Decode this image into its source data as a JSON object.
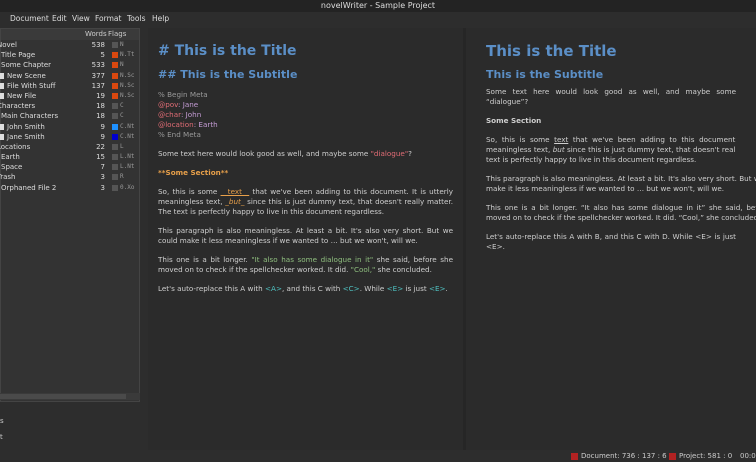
{
  "window": {
    "title": "novelWriter - Sample Project"
  },
  "menu": [
    "t",
    "Document",
    "Edit",
    "View",
    "Format",
    "Tools",
    "Help"
  ],
  "tree": {
    "headers": {
      "words": "Words",
      "flags": "Flags"
    },
    "rows": [
      {
        "name": "Novel",
        "words": "538",
        "color": "#555555",
        "flags": "N",
        "indent": 0,
        "file": false
      },
      {
        "name": "Title Page",
        "words": "5",
        "color": "#d9480f",
        "flags": "N.Tt",
        "indent": 1,
        "file": false
      },
      {
        "name": "Some Chapter",
        "words": "533",
        "color": "#d9480f",
        "flags": "N",
        "indent": 1,
        "file": false
      },
      {
        "name": "New Scene",
        "words": "377",
        "color": "#d9480f",
        "flags": "N.Sc",
        "indent": 2,
        "file": true
      },
      {
        "name": "File With Stuff",
        "words": "137",
        "color": "#d9480f",
        "flags": "N.Sc",
        "indent": 2,
        "file": true
      },
      {
        "name": "New File",
        "words": "19",
        "color": "#d9480f",
        "flags": "N.Sc",
        "indent": 2,
        "file": true
      },
      {
        "name": "Characters",
        "words": "18",
        "color": "#555555",
        "flags": "C",
        "indent": 0,
        "file": false
      },
      {
        "name": "Main Characters",
        "words": "18",
        "color": "#555555",
        "flags": "C",
        "indent": 1,
        "file": false
      },
      {
        "name": "John Smith",
        "words": "9",
        "color": "#1e90ff",
        "flags": "C.Nt",
        "indent": 2,
        "file": true
      },
      {
        "name": "Jane Smith",
        "words": "9",
        "color": "#0000cd",
        "flags": "C.Nt",
        "indent": 2,
        "file": true
      },
      {
        "name": "Locations",
        "words": "22",
        "color": "#555555",
        "flags": "L",
        "indent": 0,
        "file": false
      },
      {
        "name": "Earth",
        "words": "15",
        "color": "#555555",
        "flags": "L.Nt",
        "indent": 1,
        "file": false
      },
      {
        "name": "Space",
        "words": "7",
        "color": "#555555",
        "flags": "L.Nt",
        "indent": 1,
        "file": false
      },
      {
        "name": "Trash",
        "words": "3",
        "color": "#555555",
        "flags": "R",
        "indent": 0,
        "file": false
      },
      {
        "name": "Orphaned File 2",
        "words": "3",
        "color": "#555555",
        "flags": "0.Xo",
        "indent": 1,
        "file": false
      }
    ]
  },
  "side_extra": [
    "s",
    "t"
  ],
  "editor": {
    "title": "# This is the Title",
    "subtitle": "## This is the Subtitle",
    "meta_begin": "% Begin Meta",
    "pov_kw": "@pov",
    "pov_val": ": Jane",
    "char_kw": "@char",
    "char_val": ": John",
    "loc_kw": "@location",
    "loc_val": ": Earth",
    "meta_end": "% End Meta",
    "p1a": "Some text here would look good as well, and maybe some ",
    "p1d": "\"dialogue\"",
    "p1b": "?",
    "section": "**Some Section**",
    "p2a": "So, this is some ",
    "p2e1": "__text__",
    "p2b": " that we've been adding to this document. It is utterly meaningless text, ",
    "p2e2": "_but_",
    "p2c": " since this is just dummy text, that doesn't really matter. The text is perfectly happy to live in this document regardless.",
    "p3": "This paragraph is also meaningless. At least a bit. It's also very short. But we could make it less meaningless if we wanted to … but we won't, will we.",
    "p4a": "This one is a bit longer. ",
    "p4d1": "\"It also has some dialogue in it\"",
    "p4b": " she said, before she moved on to check if the spellchecker worked. It did. ",
    "p4d2": "\"Cool,\"",
    "p4c": " she concluded.",
    "p5a": "Let's auto-replace this A with ",
    "p5r1": "<A>",
    "p5b": ", and this C with ",
    "p5r2": "<C>",
    "p5c": ".  While ",
    "p5r3": "<E>",
    "p5d": " is just ",
    "p5r4": "<E>",
    "p5e": "."
  },
  "viewer": {
    "title": "This is the Title",
    "subtitle": "This is the Subtitle",
    "p1": "Some text here would look good as well, and maybe some “dialogue”?",
    "section": "Some Section",
    "p2a": "So, this is some ",
    "p2u": "text",
    "p2b": " that we've been adding to this document. It is utterly meaningless text, ",
    "p2i": "but",
    "p2c": " since this is just dummy text, that doesn't really matter. The text is perfectly happy to live in this document regardless.",
    "p3": "This paragraph is also meaningless. At least a bit. It's also very short. But we could make it less meaningless if we wanted to … but we won't, will we.",
    "p4": "This one is a bit longer. “It also has some dialogue in it” she said, before she moved on to check if the spellchecker worked. It did. “Cool,” she concluded.",
    "p5": "Let's auto-replace this A with B, and this C with D. While <E> is just <E>."
  },
  "status": {
    "document": "Document: 736 : 137 : 6",
    "project": "Project: 581 : 0",
    "time": "00:0",
    "led_color": "#b22222"
  }
}
